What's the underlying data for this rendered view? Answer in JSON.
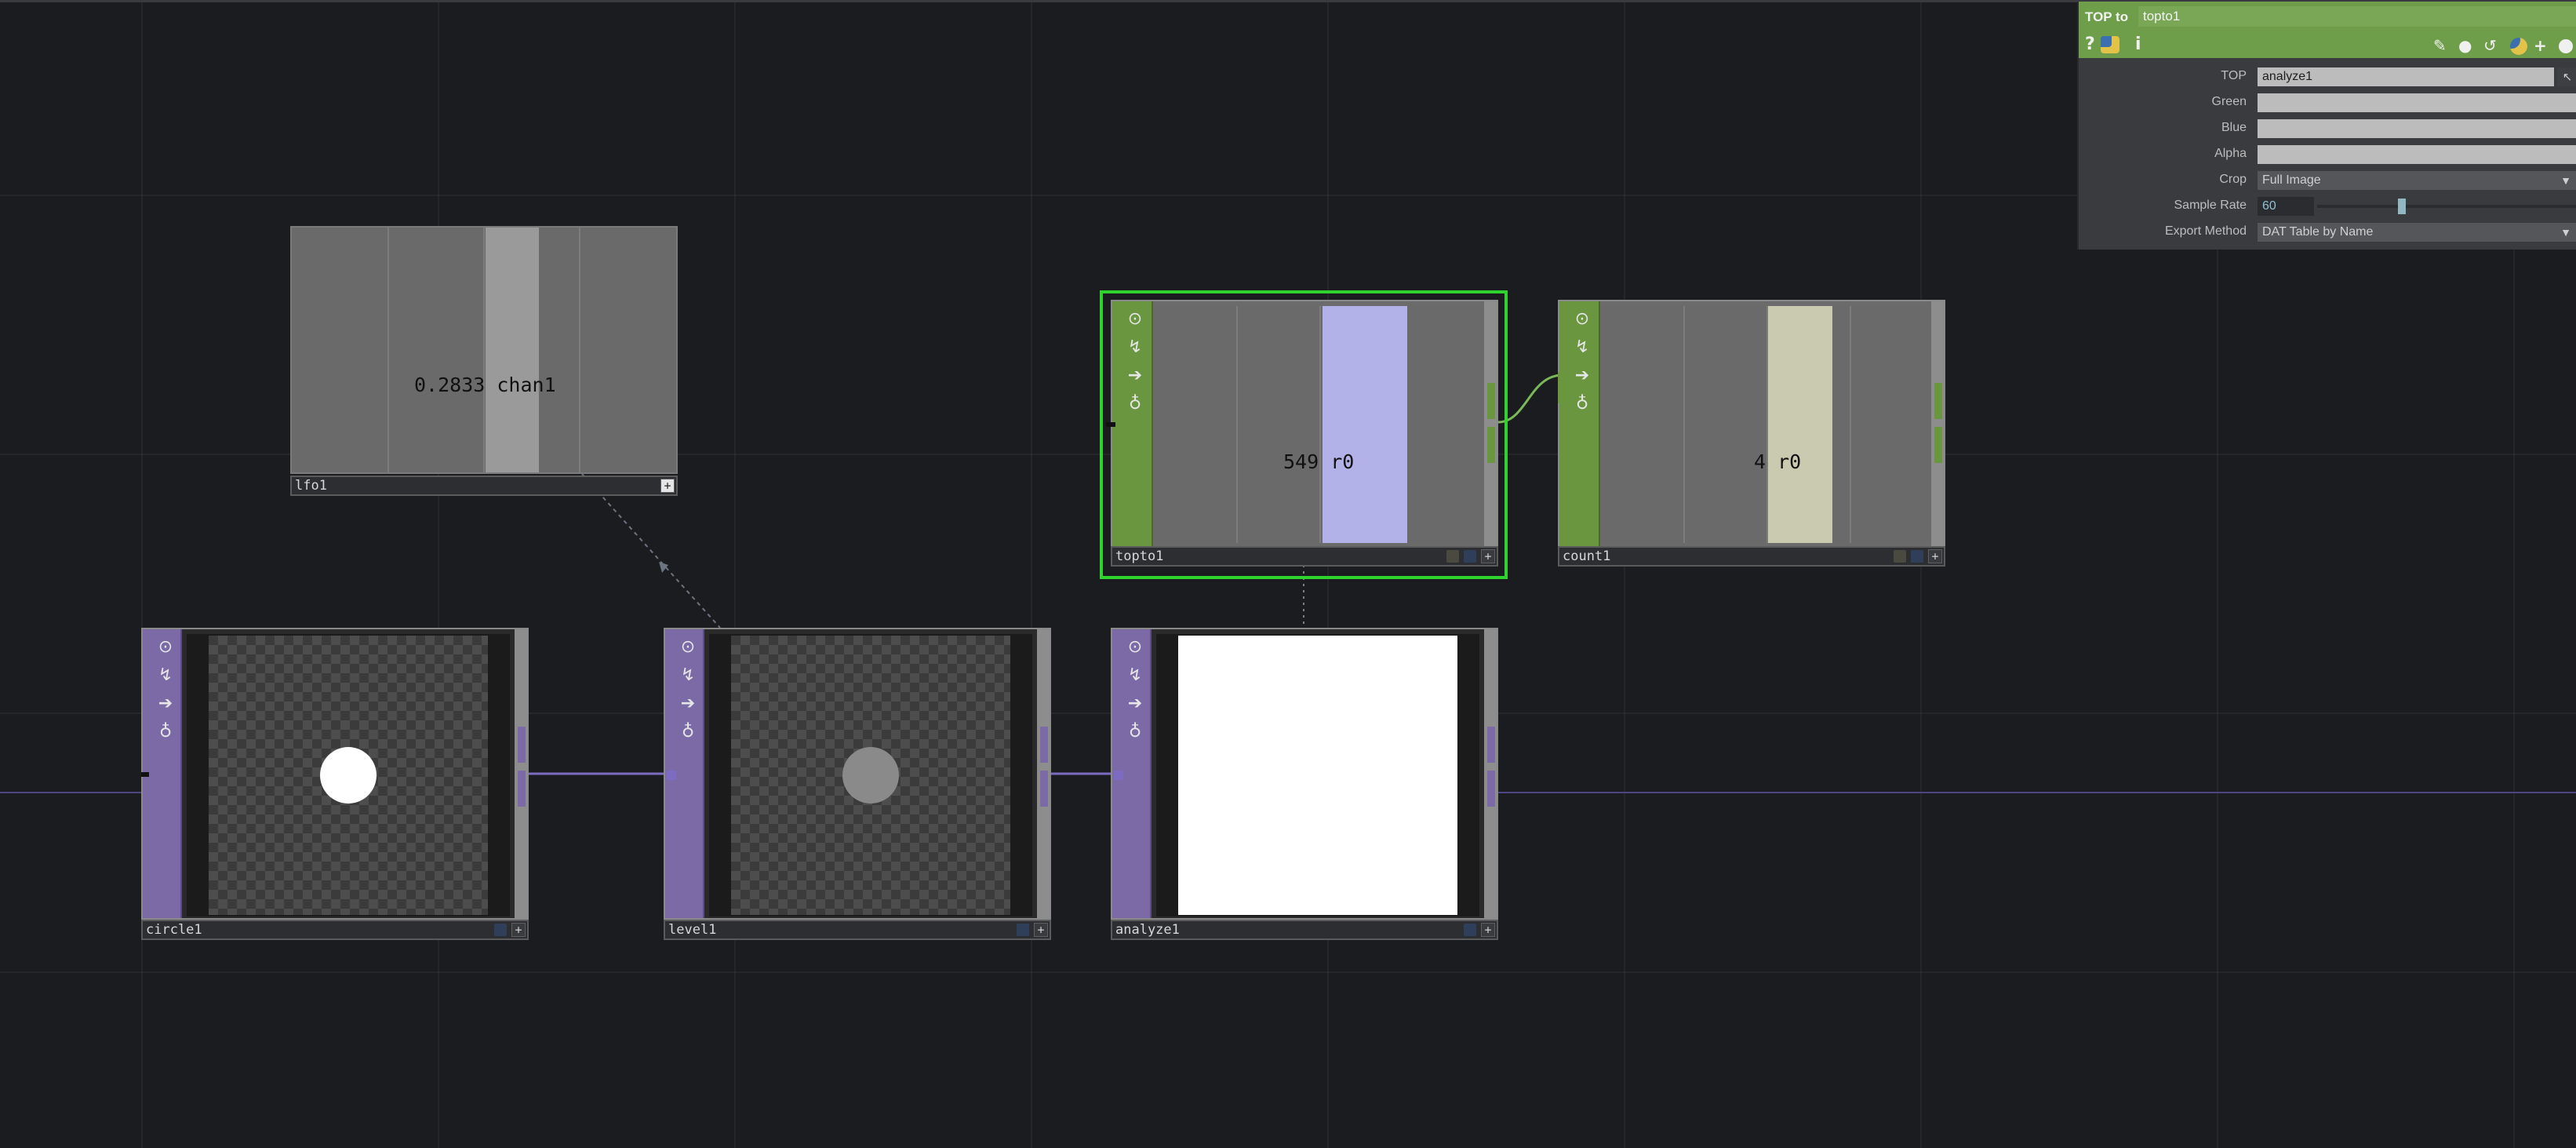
{
  "parameter_panel": {
    "op_type": "TOP to",
    "op_name": "topto1",
    "toolbar": {
      "help": "?",
      "python_help": "python-help-icon",
      "info": "i"
    },
    "params": {
      "top": {
        "label": "TOP",
        "value": "analyze1"
      },
      "green": {
        "label": "Green",
        "value": ""
      },
      "blue": {
        "label": "Blue",
        "value": ""
      },
      "alpha": {
        "label": "Alpha",
        "value": ""
      },
      "crop": {
        "label": "Crop",
        "value": "Full Image"
      },
      "sample_rate": {
        "label": "Sample Rate",
        "value": "60",
        "slider_fraction": 0.31
      },
      "export_method": {
        "label": "Export Method",
        "value": "DAT Table by Name"
      }
    }
  },
  "nodes": {
    "lfo1": {
      "name": "lfo1",
      "value": "0.2833",
      "channel": "chan1",
      "bar_color": "#9a9a9a"
    },
    "topto1": {
      "name": "topto1",
      "value": "549",
      "channel": "r0",
      "bar_color": "#b2b2e8"
    },
    "count1": {
      "name": "count1",
      "value": "4",
      "channel": "r0",
      "bar_color": "#cacab0"
    },
    "circle1": {
      "name": "circle1"
    },
    "level1": {
      "name": "level1"
    },
    "analyze1": {
      "name": "analyze1"
    }
  },
  "colors": {
    "chop_family": "#6a9640",
    "top_family": "#7b6aa6",
    "selected_outline": "#2fd22f",
    "panel_header": "#6f9e4a"
  }
}
